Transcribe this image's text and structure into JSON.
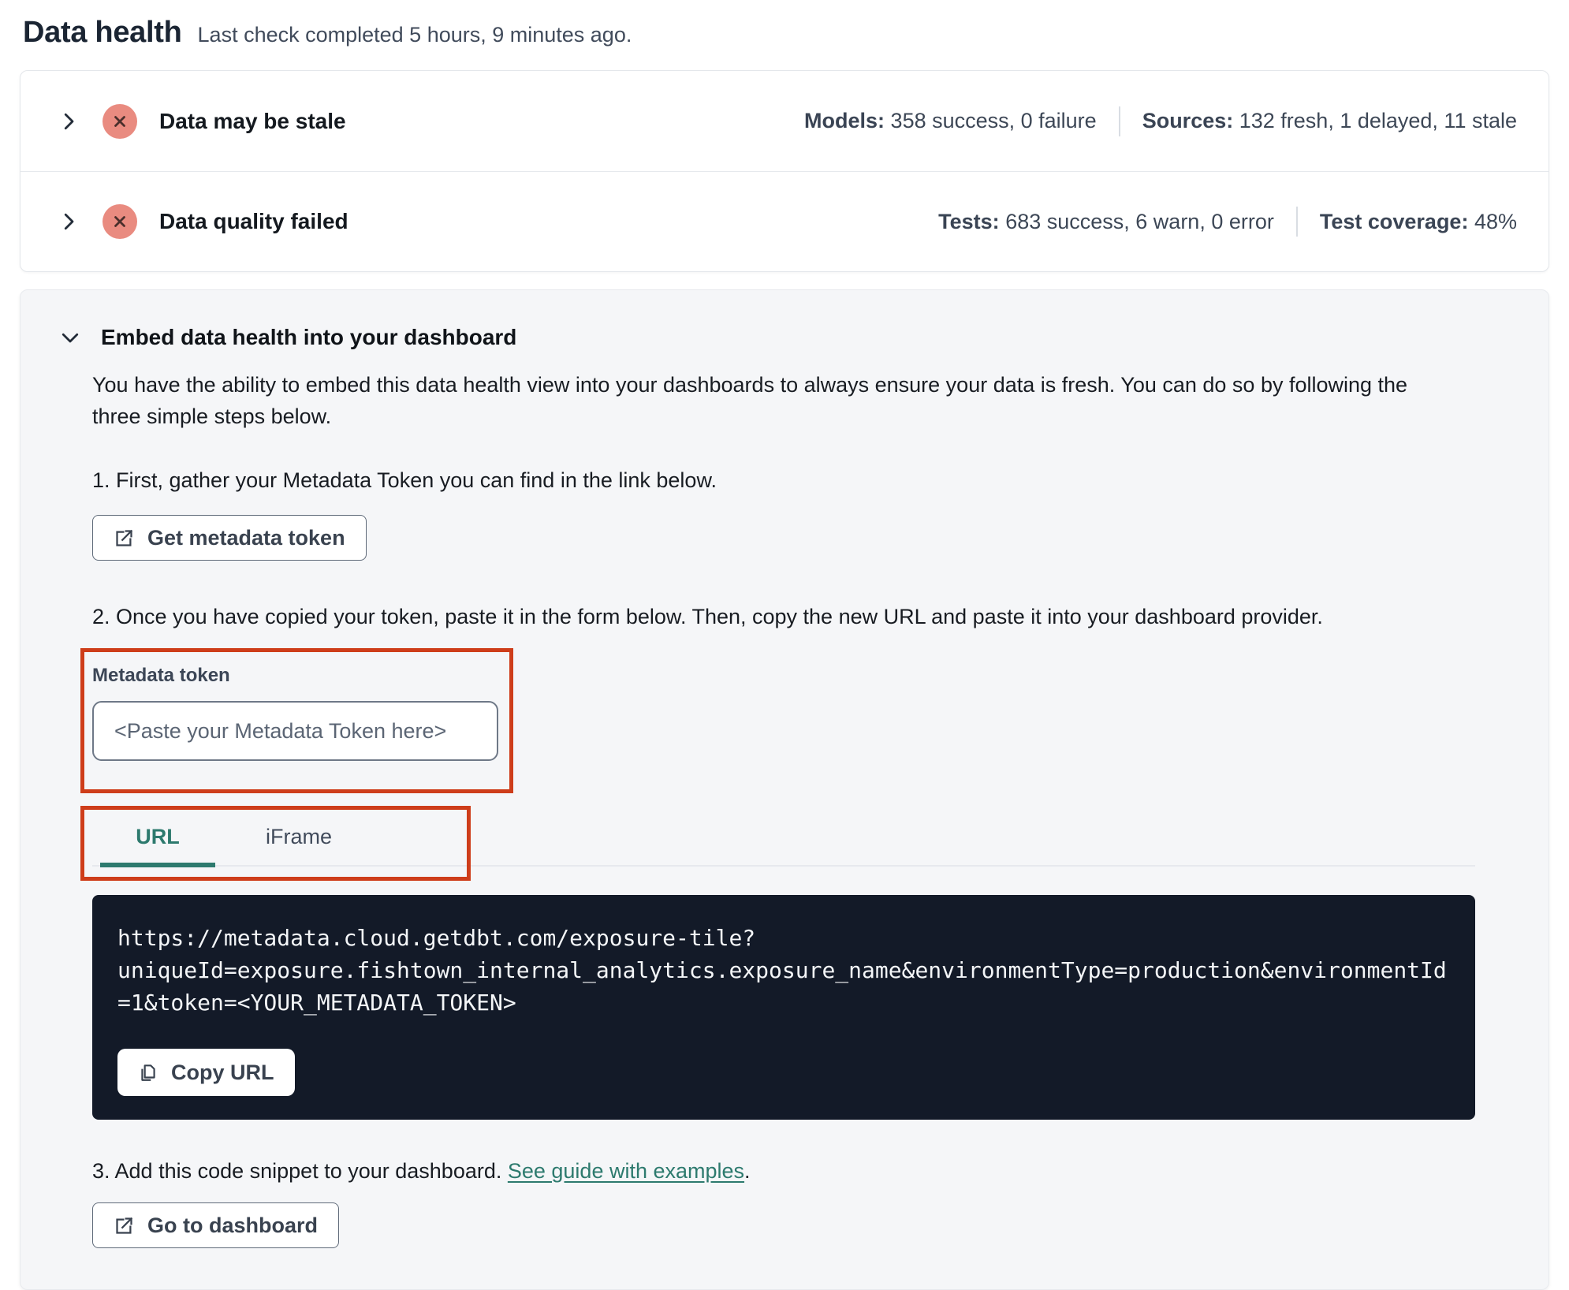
{
  "header": {
    "title": "Data health",
    "subtitle": "Last check completed 5 hours, 9 minutes ago."
  },
  "health_rows": [
    {
      "title": "Data may be stale",
      "status_icon": "x-circle-icon",
      "stats": [
        {
          "label": "Models:",
          "value": "358 success, 0 failure"
        },
        {
          "label": "Sources:",
          "value": "132 fresh, 1 delayed, 11 stale"
        }
      ]
    },
    {
      "title": "Data quality failed",
      "status_icon": "x-circle-icon",
      "stats": [
        {
          "label": "Tests:",
          "value": "683 success, 6 warn, 0 error"
        },
        {
          "label": "Test coverage:",
          "value": "48%"
        }
      ]
    }
  ],
  "embed": {
    "title": "Embed data health into your dashboard",
    "description": "You have the ability to embed this data health view into your dashboards to always ensure your data is fresh. You can do so by following the three simple steps below.",
    "step1": "1. First, gather your Metadata Token you can find in the link below.",
    "get_token_button": "Get metadata token",
    "step2": "2. Once you have copied your token, paste it in the form below. Then, copy the new URL and paste it into your dashboard provider.",
    "token_label": "Metadata token",
    "token_placeholder": "<Paste your Metadata Token here>",
    "tabs": [
      {
        "label": "URL",
        "active": true
      },
      {
        "label": "iFrame",
        "active": false
      }
    ],
    "embed_url": "https://metadata.cloud.getdbt.com/exposure-tile?uniqueId=exposure.fishtown_internal_analytics.exposure_name&environmentType=production&environmentId=1&token=<YOUR_METADATA_TOKEN>",
    "copy_url_button": "Copy URL",
    "step3_prefix": "3. Add this code snippet to your dashboard. ",
    "step3_link": "See guide with examples",
    "step3_suffix": ".",
    "dashboard_button": "Go to dashboard"
  },
  "colors": {
    "accent_teal": "#2d7a6e",
    "annotation_red": "#ce3d1a",
    "status_red_bg": "#e98b80",
    "status_red_x": "#4b2f2c",
    "code_block_bg": "#131a28"
  }
}
